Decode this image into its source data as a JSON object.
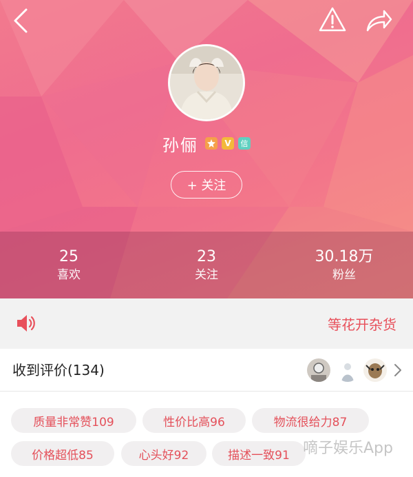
{
  "profile": {
    "name": "孙俪",
    "badges": [
      "",
      "V",
      "信"
    ],
    "follow_label": "+ 关注"
  },
  "stats": [
    {
      "value": "25",
      "label": "喜欢"
    },
    {
      "value": "23",
      "label": "关注"
    },
    {
      "value": "30.18万",
      "label": "粉丝"
    }
  ],
  "notice": {
    "text": "等花开杂货"
  },
  "reviews": {
    "title": "收到评价(134)"
  },
  "tags": [
    {
      "label": "质量非常赞109"
    },
    {
      "label": "性价比高96"
    },
    {
      "label": "物流很给力87"
    },
    {
      "label": "价格超低85"
    },
    {
      "label": "心头好92"
    },
    {
      "label": "描述一致91"
    }
  ],
  "watermark": {
    "text": "嘀子娱乐App"
  },
  "colors": {
    "accent": "#e8505b",
    "header": "#ef6d8f"
  }
}
